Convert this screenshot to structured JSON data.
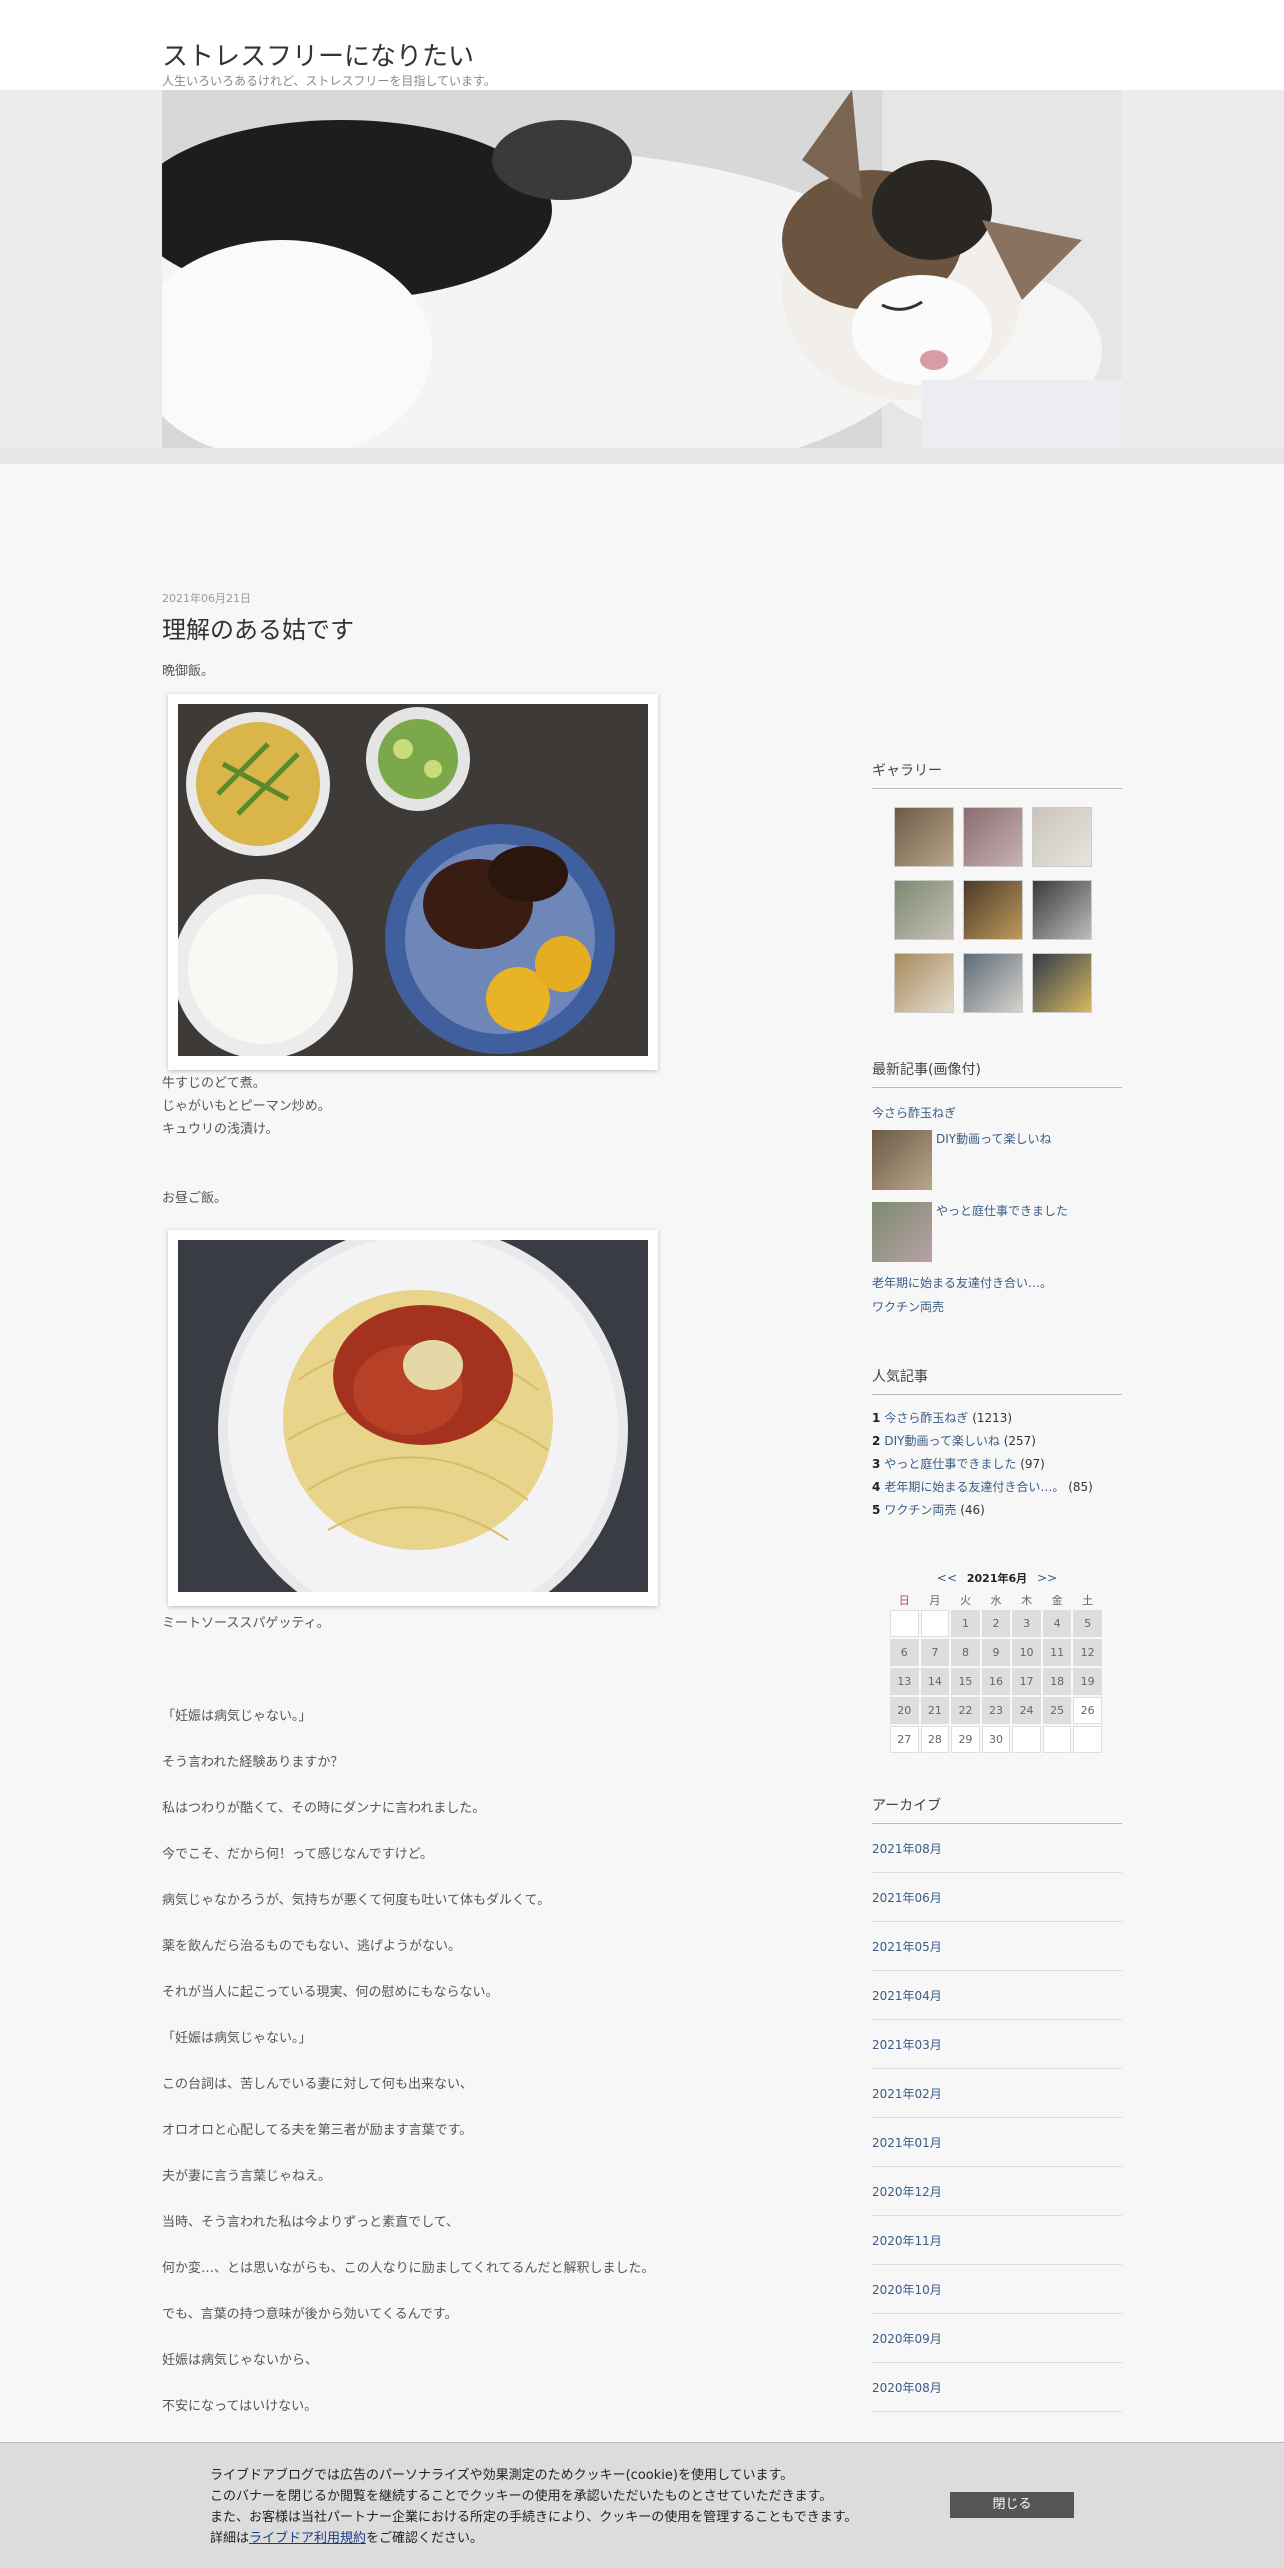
{
  "header": {
    "title": "ストレスフリーになりたい",
    "description": "人生いろいろあるけれど、ストレスフリーを目指しています。"
  },
  "post": {
    "date": "2021年06月21日",
    "title": "理解のある姑です",
    "intro": "晩御飯。",
    "dinner_lines": [
      "牛すじのどて煮。",
      "じゃがいもとピーマン炒め。",
      "キュウリの浅漬け。"
    ],
    "lunch_label": "お昼ご飯。",
    "lunch_caption": "ミートソーススパゲッティ。",
    "paragraphs": [
      "「妊娠は病気じゃない。」",
      "そう言われた経験ありますか？",
      "私はつわりが酷くて、その時にダンナに言われました。",
      "今でこそ、だから何！って感じなんですけど。",
      "病気じゃなかろうが、気持ちが悪くて何度も吐いて体もダルくて。",
      "薬を飲んだら治るものでもない、逃げようがない。",
      "それが当人に起こっている現実、何の慰めにもならない。",
      "「妊娠は病気じゃない。」",
      "この台詞は、苦しんでいる妻に対して何も出来ない、",
      "オロオロと心配してる夫を第三者が励ます言葉です。",
      "夫が妻に言う言葉じゃねえ。",
      "当時、そう言われた私は今よりずっと素直でして、",
      "何か変…、とは思いながらも、この人なりに励ましてくれてるんだと解釈しました。",
      "でも、言葉の持つ意味が後から効いてくるんです。",
      "妊娠は病気じゃないから、",
      "不安になってはいけない。"
    ]
  },
  "sidebar": {
    "gallery_title": "ギャラリー",
    "recent_title": "最新記事(画像付)",
    "recent": [
      "今さら酢玉ねぎ",
      "DIY動画って楽しいね",
      "やっと庭仕事できました",
      "老年期に始まる友達付き合い…。",
      "ワクチン両売"
    ],
    "popular_title": "人気記事",
    "popular": [
      {
        "rank": "1",
        "title": "今さら酢玉ねぎ",
        "count": "(1213)"
      },
      {
        "rank": "2",
        "title": "DIY動画って楽しいね",
        "count": "(257)"
      },
      {
        "rank": "3",
        "title": "やっと庭仕事できました",
        "count": "(97)"
      },
      {
        "rank": "4",
        "title": "老年期に始まる友達付き合い…。",
        "count": "(85)"
      },
      {
        "rank": "5",
        "title": "ワクチン両売",
        "count": "(46)"
      }
    ],
    "calendar": {
      "prev": "<<",
      "next": ">>",
      "month": "2021年6月",
      "weekdays": [
        "日",
        "月",
        "火",
        "水",
        "木",
        "金",
        "土"
      ],
      "weeks": [
        [
          "",
          "",
          "1",
          "2",
          "3",
          "4",
          "5"
        ],
        [
          "6",
          "7",
          "8",
          "9",
          "10",
          "11",
          "12"
        ],
        [
          "13",
          "14",
          "15",
          "16",
          "17",
          "18",
          "19"
        ],
        [
          "20",
          "21",
          "22",
          "23",
          "24",
          "25",
          "26"
        ],
        [
          "27",
          "28",
          "29",
          "30",
          "",
          "",
          ""
        ]
      ]
    },
    "archive_title": "アーカイブ",
    "archives": [
      "2021年08月",
      "2021年06月",
      "2021年05月",
      "2021年04月",
      "2021年03月",
      "2021年02月",
      "2021年01月",
      "2020年12月",
      "2020年11月",
      "2020年10月",
      "2020年09月",
      "2020年08月"
    ]
  },
  "cookie": {
    "line1": "ライブドアブログでは広告のパーソナライズや効果測定のためクッキー(cookie)を使用しています。",
    "line2": "このバナーを閉じるか閲覧を継続することでクッキーの使用を承認いただいたものとさせていただきます。",
    "line3": "また、お客様は当社パートナー企業における所定の手続きにより、クッキーの使用を管理することもできます。",
    "line4_prefix": "詳細は",
    "line4_link": "ライブドア利用規約",
    "line4_suffix": "をご確認ください。",
    "close_label": "閉じる"
  }
}
